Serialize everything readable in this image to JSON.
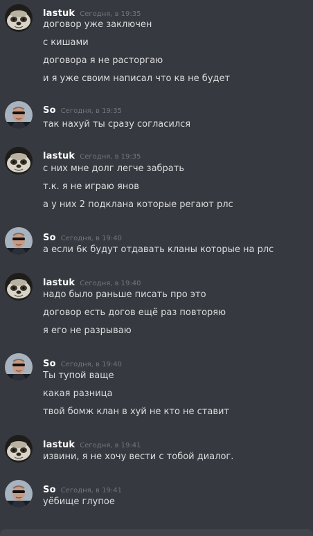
{
  "users": {
    "lastuk": "lastuk",
    "so": "So"
  },
  "groups": [
    {
      "author": "lastuk",
      "time": "Сегодня, в 19:35",
      "lines": [
        "договор уже заключен",
        "с кишами",
        "договора я не расторгаю",
        "и я уже своим написал что кв не будет"
      ]
    },
    {
      "author": "So",
      "time": "Сегодня, в 19:35",
      "lines": [
        "так нахуй ты сразу согласился"
      ]
    },
    {
      "author": "lastuk",
      "time": "Сегодня, в 19:35",
      "lines": [
        "с них мне долг легче забрать",
        "т.к. я не играю янов",
        "а у них 2 подклана которые регают рлс"
      ]
    },
    {
      "author": "So",
      "time": "Сегодня, в 19:40",
      "lines": [
        "а если 6к будут отдавать кланы которые на рлс"
      ]
    },
    {
      "author": "lastuk",
      "time": "Сегодня, в 19:40",
      "lines": [
        "надо было раньше писать про это",
        "договор есть догов ещё раз повторяю",
        "я его не разрываю"
      ]
    },
    {
      "author": "So",
      "time": "Сегодня, в 19:40",
      "lines": [
        "Ты тупой ваще",
        "какая разница",
        "твой бомж клан в хуй не кто не ставит"
      ]
    },
    {
      "author": "lastuk",
      "time": "Сегодня, в 19:41",
      "lines": [
        "извини, я не хочу вести с тобой диалог."
      ]
    },
    {
      "author": "So",
      "time": "Сегодня, в 19:41",
      "lines": [
        "уёбище глупое"
      ]
    }
  ],
  "colors": {
    "background": "#36393f",
    "author": "#ffffff",
    "timestamp": "#72767d",
    "message": "#dcddde"
  }
}
